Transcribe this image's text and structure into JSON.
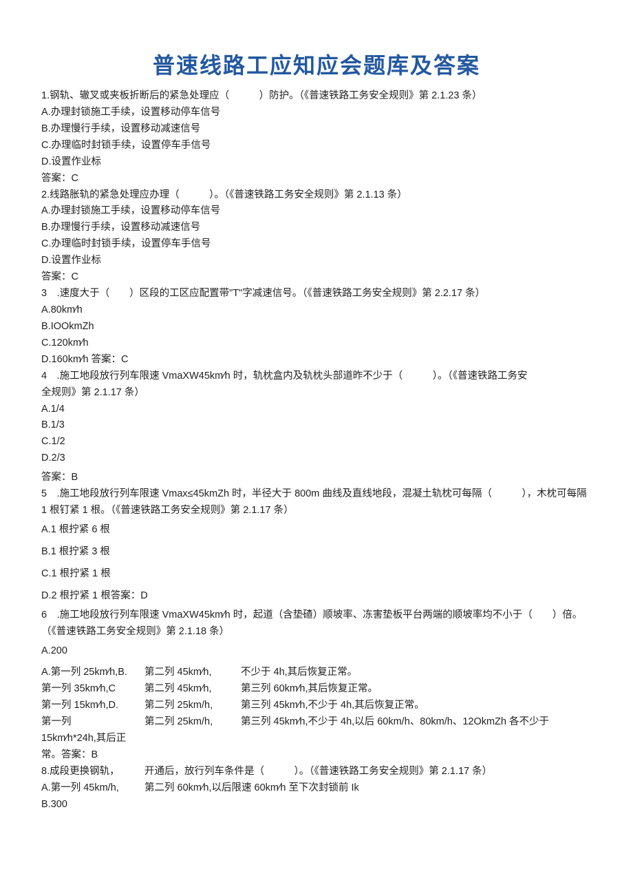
{
  "title": "普速线路工应知应会题库及答案",
  "q1": {
    "stem": "1.钢轨、辙叉或夹板折断后的紧急处理应（　　　）防护。（《普速铁路工务安全规则》第 2.1.23 条）",
    "A": "A.办理封锁施工手续，设置移动停车信号",
    "B": "B.办理慢行手续，设置移动减速信号",
    "C": "C.办理临时封锁手续，设置停车手信号",
    "D": "D.设置作业标",
    "ans": "答案：C"
  },
  "q2": {
    "stem": "2.线路胀轨的紧急处理应办理（　　　）。（《普速铁路工务安全规则》第 2.1.13 条）",
    "A": "A.办理封锁施工手续，设置移动停车信号",
    "B": "B.办理慢行手续，设置移动减速信号",
    "C": "C.办理临时封锁手续，设置停车手信号",
    "D": "D.设置作业标",
    "ans": "答案：C"
  },
  "q3": {
    "stem": "3　.速度大于（　　）区段的工区应配置带\"T\"字减速信号。（《普速铁路工务安全规则》第 2.2.17 条）",
    "A": "A.80km∕h",
    "B": "B.IOOkmZh",
    "C": "C.120km∕h",
    "D": "D.160km∕h 答案：C"
  },
  "q4": {
    "stem1": "4　.施工地段放行列车限速 VmaXW45km∕h 时，轨枕盒内及轨枕头部道昨不少于（　　　）。（《普速铁路工务安",
    "stem2": "全规则》第 2.1.17 条）",
    "A": "A.1/4",
    "B": "B.1/3",
    "C": "C.1/2",
    "D": "D.2/3",
    "ans": "答案：B"
  },
  "q5": {
    "stem": "5　.施工地段放行列车限速 Vmax≤45kmZh 时，半径大于 800m 曲线及直线地段，混凝土轨枕可每隔（　　　），木枕可每隔 1 根钉紧 1 根。（《普速铁路工务安全规则》第 2.1.17 条）",
    "A": "A.1 根拧紧 6 根",
    "B": "B.1 根拧紧 3 根",
    "C": "C.1 根拧紧 1 根",
    "D": "D.2 根拧紧 1 根答案：D"
  },
  "q6": {
    "stem": "6　.施工地段放行列车限速 VmaXW45km∕h 时，起道（含垫碴）顺坡率、冻害垫板平台两端的顺坡率均不小于（　　）倍。（《普速铁路工务安全规则》第 2.1.18 条）",
    "A": "A.200"
  },
  "table": {
    "r1c1": "A.第一列 25km∕h,B.",
    "r1c2": "第二列 45km∕h,",
    "r1c3": "不少于 4h,其后恢复正常。",
    "r2c1": "第一列 35km∕h,C",
    "r2c2": "第二列 45km∕h,",
    "r2c3": "第三列 60km∕h,其后恢复正常。",
    "r3c1": "第一列 15km∕h,D.",
    "r3c2": "第二列 25km/h,",
    "r3c3": "第三列 45km∕h,不少于 4h,其后恢复正常。",
    "r4c1": "第一列",
    "r4c2": "第二列 25km/h,",
    "r4c3": "第三列 45km∕h,不少于 4h,以后 60km/h、80km/h、12OkmZh 各不少于",
    "r5": "15km∕h*24h,其后正",
    "r6": "常。答案：B"
  },
  "q8": {
    "stem1a": "8.成段更换钢轨，",
    "stem1b": "开通后，放行列车条件是（　　　）。（《普速铁路工务安全规则》第 2.1.17 条）",
    "A1": "A.第一列 45km/h,",
    "A2": "第二列 60km∕h,以后限速 60km∕h 至下次封锁前 Ik",
    "B": "B.300"
  }
}
